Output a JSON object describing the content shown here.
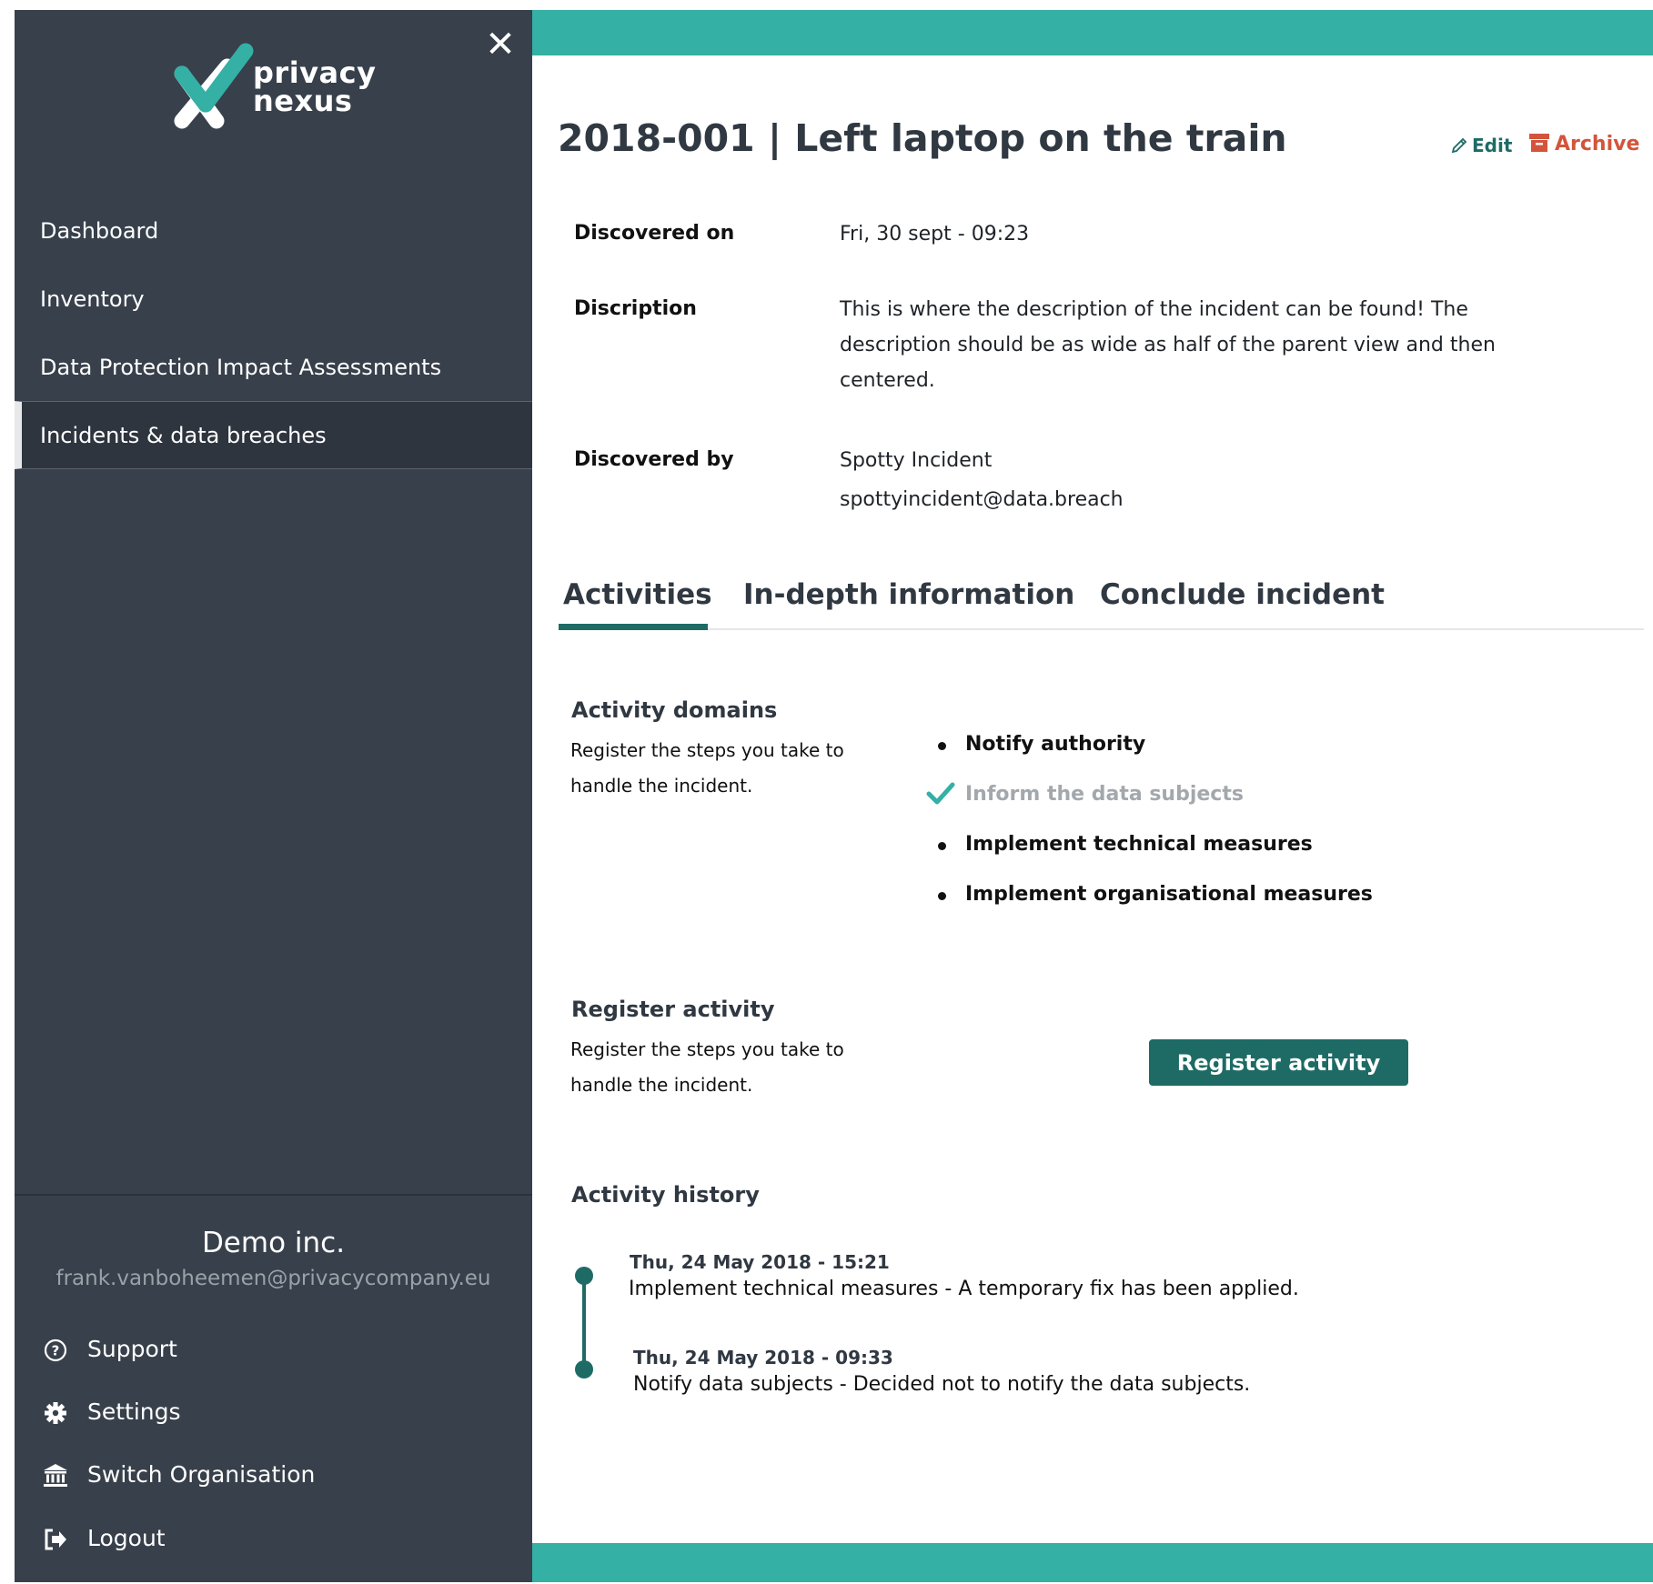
{
  "app": {
    "logo_line1": "privacy",
    "logo_line2": "nexus"
  },
  "sidebar": {
    "nav": [
      {
        "label": "Dashboard"
      },
      {
        "label": "Inventory"
      },
      {
        "label": "Data Protection Impact Assessments"
      },
      {
        "label": "Incidents & data breaches",
        "active": true
      }
    ],
    "organisation": "Demo inc.",
    "user_email": "frank.vanboheemen@privacycompany.eu",
    "footer": [
      {
        "label": "Support",
        "icon": "question-circle-icon"
      },
      {
        "label": "Settings",
        "icon": "gear-icon"
      },
      {
        "label": "Switch Organisation",
        "icon": "bank-icon"
      },
      {
        "label": "Logout",
        "icon": "logout-icon"
      }
    ]
  },
  "incident": {
    "title": "2018-001 | Left laptop on the train",
    "edit_label": "Edit",
    "archive_label": "Archive",
    "fields": {
      "discovered_on_label": "Discovered on",
      "discovered_on_value": "Fri, 30 sept - 09:23",
      "description_label": "Discription",
      "description_value": "This is where the description of the incident can be found! The description should be as wide as half of the parent view and then centered.",
      "discovered_by_label": "Discovered by",
      "discovered_by_name": "Spotty Incident",
      "discovered_by_email": "spottyincident@data.breach"
    }
  },
  "tabs": [
    {
      "label": "Activities",
      "active": true
    },
    {
      "label": "In-depth information"
    },
    {
      "label": "Conclude incident"
    }
  ],
  "activity_domains": {
    "title": "Activity domains",
    "description": "Register the steps you take to handle the incident.",
    "items": [
      {
        "label": "Notify authority",
        "done": false
      },
      {
        "label": "Inform the data subjects",
        "done": true
      },
      {
        "label": "Implement technical measures",
        "done": false
      },
      {
        "label": "Implement organisational measures",
        "done": false
      }
    ]
  },
  "register_activity": {
    "title": "Register activity",
    "description": "Register the steps you take to handle the incident.",
    "button_label": "Register activity"
  },
  "activity_history": {
    "title": "Activity history",
    "entries": [
      {
        "date": "Thu, 24 May 2018 - 15:21",
        "text": "Implement technical measures - A temporary fix has been applied."
      },
      {
        "date": "Thu, 24 May 2018 - 09:33",
        "text": "Notify data subjects - Decided not to notify the data subjects."
      }
    ]
  },
  "colors": {
    "sidebar": "#38404b",
    "accent": "#34b0a5",
    "primary": "#1e6b66",
    "archive": "#d3543b"
  }
}
